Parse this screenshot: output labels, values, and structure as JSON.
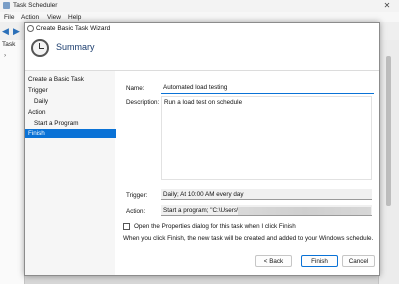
{
  "background": {
    "title": "Task Scheduler",
    "menus": [
      "File",
      "Action",
      "View",
      "Help"
    ],
    "tree_item": "Task"
  },
  "dialog": {
    "title": "Create Basic Task Wizard",
    "header": "Summary",
    "steps": [
      {
        "label": "Create a Basic Task",
        "indent": false,
        "active": false
      },
      {
        "label": "Trigger",
        "indent": false,
        "active": false
      },
      {
        "label": "Daily",
        "indent": true,
        "active": false
      },
      {
        "label": "Action",
        "indent": false,
        "active": false
      },
      {
        "label": "Start a Program",
        "indent": true,
        "active": false
      },
      {
        "label": "Finish",
        "indent": false,
        "active": true
      }
    ],
    "name_label": "Name:",
    "name_value": "Automated load testing",
    "description_label": "Description:",
    "description_value": "Run a load test on schedule",
    "trigger_label": "Trigger:",
    "trigger_value": "Daily; At 10:00 AM every day",
    "action_label": "Action:",
    "action_value": "Start a program; \"C:\\Users\\",
    "checkbox_label": "Open the Properties dialog for this task when I click Finish",
    "note": "When you click Finish, the new task will be created and added to your Windows schedule.",
    "buttons": {
      "back": "< Back",
      "finish": "Finish",
      "cancel": "Cancel"
    }
  },
  "colors": {
    "accent": "#0a72d6",
    "header_text": "#1b3d6e"
  }
}
